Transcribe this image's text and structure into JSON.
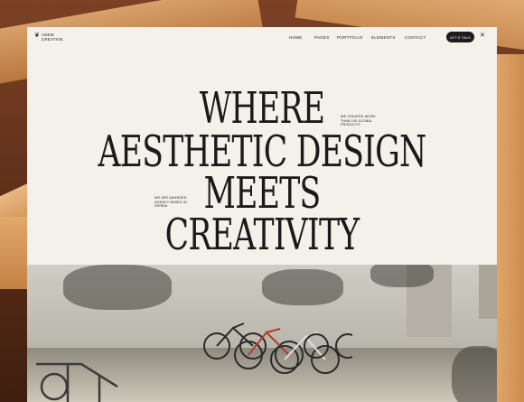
{
  "brand": {
    "line1": "ADEM",
    "line2": "CREATIVE"
  },
  "nav": {
    "items": [
      "HOME",
      "PAGES",
      "PORTFOLIO",
      "ELEMENTS",
      "CONTACT"
    ],
    "cta_label": "LET'S TALK",
    "close_glyph": "✕"
  },
  "hero": {
    "line1": "WHERE",
    "line2": "AESTHETIC DESIGN",
    "line3": "MEETS",
    "line4": "CREATIVITY",
    "note_right": "WE CREATED WORK\nTHAN 100 GLOBAL\nPRODUCTS",
    "note_left": "WE ARE AWARDED\nAGENCY BASED IN\nSERBIA"
  },
  "colors": {
    "accent_dark": "#1c1c1c",
    "background": "#f4f0ea"
  },
  "icons": {
    "close": "close-icon",
    "logo": "logo-mark-icon"
  }
}
